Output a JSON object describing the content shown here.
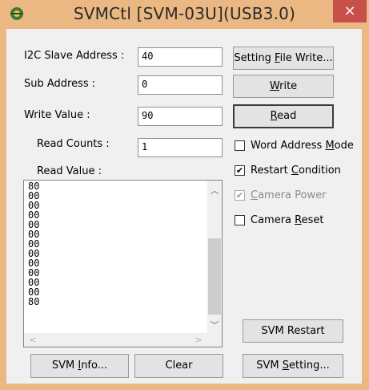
{
  "window": {
    "title": "SVMCtl [SVM-03U](USB3.0)",
    "close_glyph": "×",
    "title_bar_color": "#ebb783",
    "close_color": "#c7504a"
  },
  "form": {
    "i2c_slave_address": {
      "label": "I2C Slave Address :",
      "value": "40"
    },
    "sub_address": {
      "label": "Sub Address :",
      "value": "0"
    },
    "write_value": {
      "label": "Write Value :",
      "value": "90"
    },
    "read_counts": {
      "label": "Read Counts :",
      "value": "1"
    },
    "read_value_label": "Read Value :"
  },
  "buttons": {
    "setting_file_write": {
      "pre": "Setting ",
      "key": "F",
      "post": "ile Write..."
    },
    "write": {
      "pre": "",
      "key": "W",
      "post": "rite"
    },
    "read": {
      "pre": "",
      "key": "R",
      "post": "ead"
    },
    "svm_restart": "SVM Restart",
    "svm_info": {
      "pre": "SVM ",
      "key": "I",
      "post": "nfo..."
    },
    "clear": "Clear",
    "svm_setting": {
      "pre": "SVM ",
      "key": "S",
      "post": "etting..."
    }
  },
  "checkboxes": {
    "word_address_mode": {
      "pre": "Word Address ",
      "key": "M",
      "post": "ode",
      "checked": false,
      "enabled": true
    },
    "restart_condition": {
      "pre": "Restart ",
      "key": "C",
      "post": "ondition",
      "checked": true,
      "enabled": true
    },
    "camera_power": {
      "pre": "",
      "key": "C",
      "post": "amera Power",
      "checked": true,
      "enabled": false
    },
    "camera_reset": {
      "pre": "Camera ",
      "key": "R",
      "post": "eset",
      "checked": false,
      "enabled": true
    }
  },
  "read_values": [
    "80",
    "00",
    "00",
    "00",
    "00",
    "00",
    "00",
    "00",
    "00",
    "00",
    "00",
    "00",
    "80"
  ],
  "icons": {
    "app": "app-logo-icon",
    "check": "✔",
    "scroll_up": "︿",
    "scroll_down": "﹀",
    "scroll_left": "<",
    "scroll_right": ">"
  }
}
